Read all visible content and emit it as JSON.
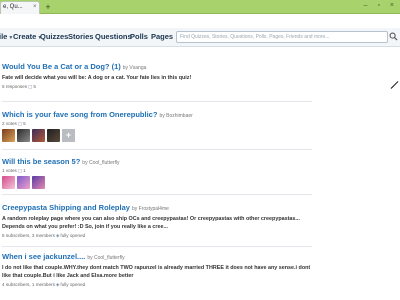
{
  "browser": {
    "tab_title": "e, Qu...",
    "tab_close": "×",
    "new_tab": "+",
    "window_controls": "– ▫ ×"
  },
  "nav": {
    "items": [
      {
        "label": "ile",
        "caret": true
      },
      {
        "label": "Create",
        "caret": true
      },
      {
        "label": "Quizzes",
        "caret": false
      },
      {
        "label": "Stories",
        "caret": false
      },
      {
        "label": "Questions",
        "caret": false
      },
      {
        "label": "Polls",
        "caret": false
      },
      {
        "label": "Pages",
        "caret": false
      }
    ],
    "search_placeholder": "Find Quizzes, Stories, Questions, Polls, Pages, Friends and more..."
  },
  "feed": [
    {
      "title": "Would You Be a Cat or a Dog? (1)",
      "by": "by Vsanga",
      "desc": "Fate will decide what you will be: A dog or a cat. Your fate lies in this quiz!",
      "meta_a": "5 responses",
      "meta_b": "5"
    },
    {
      "title": "Which is your fave song from Onerepublic?",
      "by": "by Bozhimbaer",
      "meta_a": "2 votes",
      "meta_b": "5"
    },
    {
      "title": "Will this be season 5?",
      "by": "by Cool_flutterfly",
      "meta_a": "1 votes",
      "meta_b": "1"
    },
    {
      "title": "Creepypasta Shipping and Roleplay",
      "by": "by Frostypal4me",
      "desc": "A random roleplay page where you can also ship OCs and creepypastas! Or creepypastas with other creepypastas... Depends on what you prefer! :D So, join if you really like a cree...",
      "meta_a": "5 subscribers",
      "meta_b": "3 members",
      "meta_c": "fully opened"
    },
    {
      "title": "When i see jackunzel....",
      "by": "by Cool_flutterfly",
      "desc": "I do not like that couple.WHY.they dont match TWO rapunzel is already married THREE it does not have any sense.i dont like that couple.But i like Jack and Elsa.more better",
      "meta_a": "4 subscribers",
      "meta_b": "1 members",
      "meta_c": "fully opened"
    }
  ],
  "colors": {
    "chrome": "#a8d26b",
    "link": "#1f6fb5",
    "nav_bg": "#f3f6f9"
  }
}
